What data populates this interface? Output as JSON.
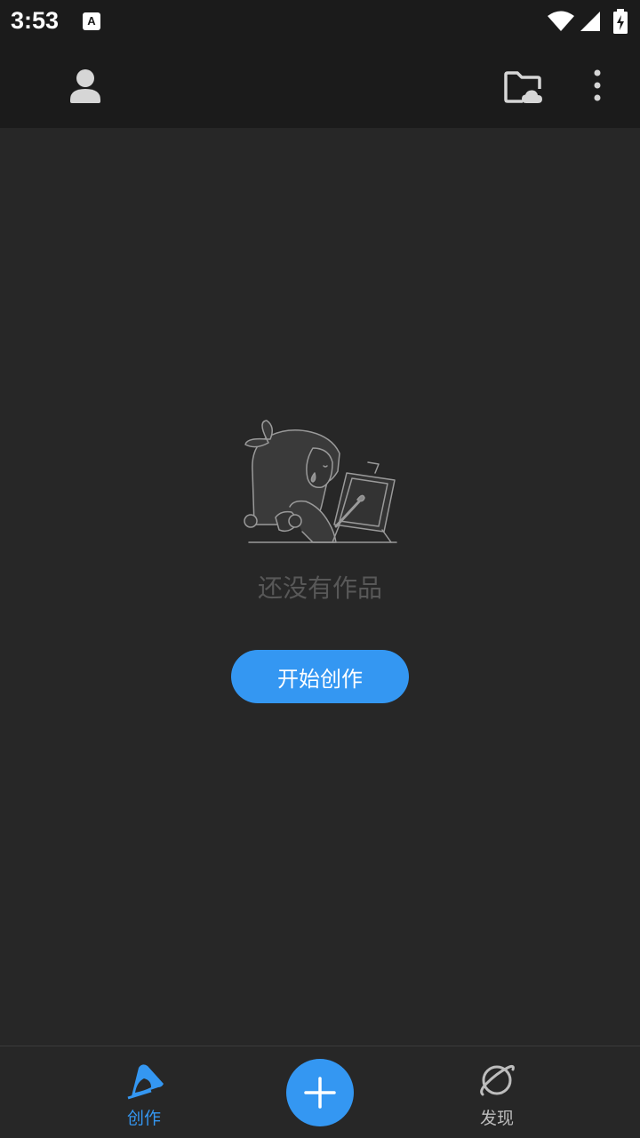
{
  "status_bar": {
    "time": "3:53",
    "notification_icon": "a-icon",
    "wifi_icon": "wifi-icon",
    "signal_icon": "signal-icon",
    "battery_icon": "battery-charging-icon"
  },
  "app_bar": {
    "profile_icon": "person-icon",
    "cloud_icon": "cloud-folder-icon",
    "more_icon": "more-vert-icon"
  },
  "empty_state": {
    "illustration": "girl-drawing-illustration",
    "message": "还没有作品",
    "button_label": "开始创作"
  },
  "bottom_nav": {
    "items": [
      {
        "label": "创作",
        "icon": "pencil-icon",
        "active": true
      },
      {
        "label": "发现",
        "icon": "planet-icon",
        "active": false
      }
    ],
    "fab_icon": "plus-icon"
  },
  "colors": {
    "accent": "#3497f2",
    "background": "#272727",
    "app_bar": "#1b1b1b",
    "muted_text": "#585858"
  }
}
